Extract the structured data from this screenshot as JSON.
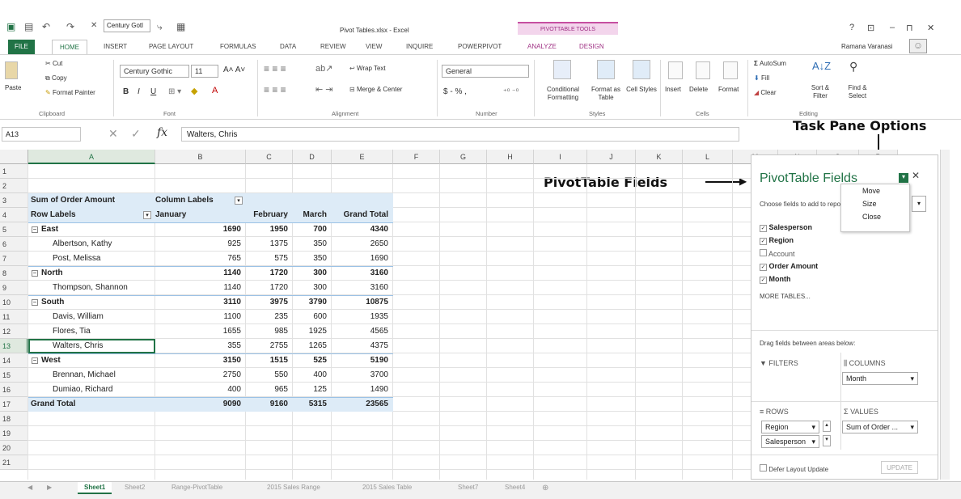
{
  "window": {
    "file_title": "Pivot Tables.xlsx - Excel",
    "font_name": "Century Gotl",
    "contextual_group": "PIVOTTABLE TOOLS",
    "user": "Ramana Varanasi",
    "controls": [
      "?",
      "⊡",
      "–",
      "⊓",
      "✕"
    ]
  },
  "tabs": [
    "FILE",
    "HOME",
    "INSERT",
    "PAGE LAYOUT",
    "FORMULAS",
    "DATA",
    "REVIEW",
    "VIEW",
    "INQUIRE",
    "POWERPIVOT",
    "ANALYZE",
    "DESIGN"
  ],
  "ribbon": {
    "clipboard": {
      "paste": "Paste",
      "cut": "Cut",
      "copy": "Copy",
      "format_painter": "Format Painter",
      "label": "Clipboard"
    },
    "font": {
      "name": "Century Gothic",
      "size": "11",
      "bold": "B",
      "italic": "I",
      "underline": "U",
      "label": "Font"
    },
    "alignment": {
      "wrap": "Wrap Text",
      "merge": "Merge & Center",
      "label": "Alignment"
    },
    "number": {
      "format": "General",
      "currency": "$ - % ,",
      "label": "Number"
    },
    "styles": {
      "conditional": "Conditional Formatting",
      "format_table": "Format as Table",
      "cell_styles": "Cell Styles",
      "label": "Styles"
    },
    "cells": {
      "insert": "Insert",
      "delete": "Delete",
      "format": "Format",
      "label": "Cells"
    },
    "editing": {
      "autosum": "AutoSum",
      "fill": "Fill",
      "clear": "Clear",
      "sort": "Sort & Filter",
      "find": "Find & Select",
      "label": "Editing"
    }
  },
  "formula_bar": {
    "name_box": "A13",
    "fx": "fx",
    "value": "Walters, Chris"
  },
  "annotations": {
    "task_pane_options": "Task Pane Options",
    "pivot_fields": "PivotTable Fields"
  },
  "columns": [
    "A",
    "B",
    "C",
    "D",
    "E",
    "F",
    "G",
    "H",
    "I",
    "J",
    "K",
    "L",
    "M",
    "N",
    "O",
    "P"
  ],
  "rows": [
    "1",
    "2",
    "3",
    "4",
    "5",
    "6",
    "7",
    "8",
    "9",
    "10",
    "11",
    "12",
    "13",
    "14",
    "15",
    "16",
    "17",
    "18",
    "19",
    "20",
    "21"
  ],
  "pivot": {
    "header1": {
      "a": "Sum of Order Amount",
      "b": "Column Labels"
    },
    "header2": {
      "a": "Row Labels",
      "b": "January",
      "c": "February",
      "d": "March",
      "e": "Grand Total"
    },
    "rows": [
      {
        "label": "East",
        "type": "group",
        "b": "1690",
        "c": "1950",
        "d": "700",
        "e": "4340"
      },
      {
        "label": "Albertson, Kathy",
        "type": "item",
        "b": "925",
        "c": "1375",
        "d": "350",
        "e": "2650"
      },
      {
        "label": "Post, Melissa",
        "type": "item",
        "b": "765",
        "c": "575",
        "d": "350",
        "e": "1690"
      },
      {
        "label": "North",
        "type": "group",
        "b": "1140",
        "c": "1720",
        "d": "300",
        "e": "3160"
      },
      {
        "label": "Thompson, Shannon",
        "type": "item",
        "b": "1140",
        "c": "1720",
        "d": "300",
        "e": "3160"
      },
      {
        "label": "South",
        "type": "group",
        "b": "3110",
        "c": "3975",
        "d": "3790",
        "e": "10875"
      },
      {
        "label": "Davis, William",
        "type": "item",
        "b": "1100",
        "c": "235",
        "d": "600",
        "e": "1935"
      },
      {
        "label": "Flores, Tia",
        "type": "item",
        "b": "1655",
        "c": "985",
        "d": "1925",
        "e": "4565"
      },
      {
        "label": "Walters, Chris",
        "type": "item",
        "b": "355",
        "c": "2755",
        "d": "1265",
        "e": "4375"
      },
      {
        "label": "West",
        "type": "group",
        "b": "3150",
        "c": "1515",
        "d": "525",
        "e": "5190"
      },
      {
        "label": "Brennan, Michael",
        "type": "item",
        "b": "2750",
        "c": "550",
        "d": "400",
        "e": "3700"
      },
      {
        "label": "Dumiao, Richard",
        "type": "item",
        "b": "400",
        "c": "965",
        "d": "125",
        "e": "1490"
      },
      {
        "label": "Grand Total",
        "type": "total",
        "b": "9090",
        "c": "9160",
        "d": "5315",
        "e": "23565"
      }
    ]
  },
  "pane": {
    "title": "PivotTable Fields",
    "choose": "Choose fields to add to report:",
    "fields": [
      {
        "name": "Salesperson",
        "checked": true
      },
      {
        "name": "Region",
        "checked": true
      },
      {
        "name": "Account",
        "checked": false
      },
      {
        "name": "Order Amount",
        "checked": true
      },
      {
        "name": "Month",
        "checked": true
      }
    ],
    "more_tables": "MORE TABLES...",
    "drag_hint": "Drag fields between areas below:",
    "filters": "FILTERS",
    "columns": "COLUMNS",
    "columns_item": "Month",
    "rows": "ROWS",
    "rows_items": [
      "Region",
      "Salesperson"
    ],
    "values": "VALUES",
    "values_item": "Sum of Order ...",
    "defer": "Defer Layout Update",
    "update": "UPDATE",
    "menu": [
      "Move",
      "Size",
      "Close"
    ]
  },
  "sheets": [
    "Sheet1",
    "Sheet2",
    "Range-PivotTable",
    "2015 Sales Range",
    "2015 Sales Table",
    "Sheet7",
    "Sheet4"
  ],
  "colors": {
    "accent": "#217346",
    "pivot_header": "#ddebf7",
    "contextual": "#a03385"
  }
}
